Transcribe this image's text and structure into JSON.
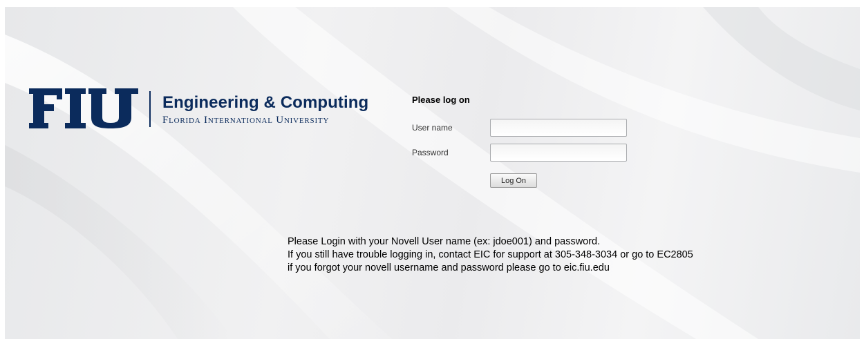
{
  "logo": {
    "mark_text": "FIU",
    "title": "Engineering & Computing",
    "subtitle": "Florida International University",
    "brand_color": "#0b2b5c"
  },
  "form": {
    "title": "Please log on",
    "username_label": "User name",
    "username_value": "",
    "password_label": "Password",
    "password_value": "",
    "logon_button": "Log On"
  },
  "info": {
    "line1": "Please Login with your Novell User name (ex: jdoe001) and password.",
    "line2": "If you still have trouble logging in, contact EIC for support at 305-348-3034 or  go to EC2805",
    "line3": "if  you forgot your novell username and password please  go to eic.fiu.edu"
  }
}
